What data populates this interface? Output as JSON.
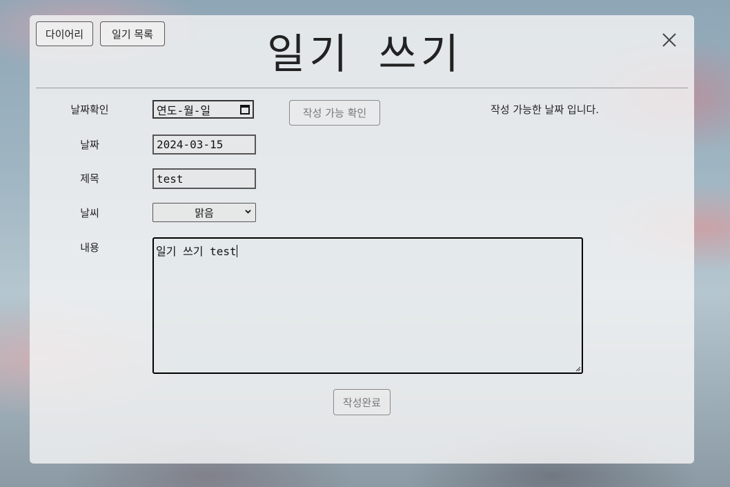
{
  "header": {
    "title": "일기 쓰기",
    "nav": {
      "diary_label": "다이어리",
      "list_label": "일기 목록"
    },
    "close_icon": "close-icon"
  },
  "form": {
    "date_check": {
      "label": "날짜확인",
      "value": "연도-월-일",
      "check_button": "작성 가능 확인",
      "status": "작성 가능한 날짜 입니다."
    },
    "date": {
      "label": "날짜",
      "value": "2024-03-15"
    },
    "title": {
      "label": "제목",
      "value": "test"
    },
    "weather": {
      "label": "날씨",
      "selected": "맑음"
    },
    "content": {
      "label": "내용",
      "value": "일기 쓰기 test"
    },
    "submit_label": "작성완료"
  }
}
